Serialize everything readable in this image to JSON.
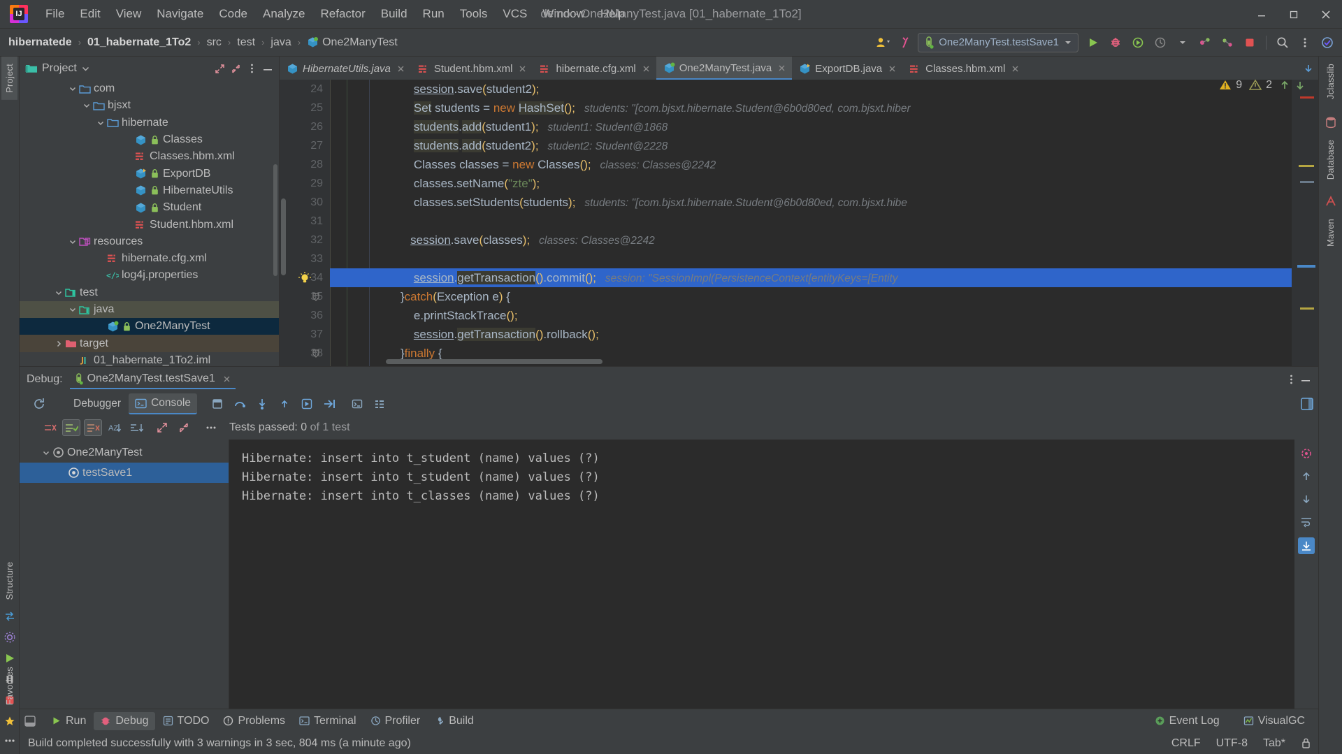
{
  "window": {
    "title": "demo - One2ManyTest.java [01_habernate_1To2]",
    "minimize": "minimize-icon",
    "maximize": "maximize-icon",
    "close": "close-icon"
  },
  "menu": [
    "File",
    "Edit",
    "View",
    "Navigate",
    "Code",
    "Analyze",
    "Refactor",
    "Build",
    "Run",
    "Tools",
    "VCS",
    "Window",
    "Help"
  ],
  "breadcrumbs": [
    {
      "label": "hibernatede",
      "bold": true
    },
    {
      "label": "01_habernate_1To2",
      "bold": true
    },
    {
      "label": "src",
      "bold": false
    },
    {
      "label": "test",
      "bold": false
    },
    {
      "label": "java",
      "bold": false
    },
    {
      "label": "One2ManyTest",
      "bold": false,
      "icon": "java-class-icon"
    }
  ],
  "toolbar": {
    "run_config": "One2ManyTest.testSave1",
    "run_config_icon": "test-tube-icon",
    "dropdown_icon": "chevron-down-icon",
    "run_icon": "run-icon",
    "debug_icon": "debug-icon",
    "run_with_coverage_icon": "run-coverage-icon",
    "profiler_icon": "profiler-icon",
    "stop_icon": "stop-icon",
    "search_icon": "search-icon",
    "more_icon": "more-vertical-icon",
    "updates_icon": "updates-icon",
    "share_icon": "share-icon",
    "users_icon": "users-icon"
  },
  "project_panel": {
    "title": "Project",
    "title_dropdown": "chevron-down-icon",
    "expand_icon": "expand-icon",
    "collapse_icon": "collapse-icon",
    "more_icon": "more-vertical-icon",
    "hide_icon": "hide-icon",
    "tree": [
      {
        "label": "com",
        "indent": 4,
        "arrow": "down",
        "icon": "folder-blue-icon",
        "state": "none"
      },
      {
        "label": "bjsxt",
        "indent": 5,
        "arrow": "down",
        "icon": "folder-blue-icon",
        "state": "none"
      },
      {
        "label": "hibernate",
        "indent": 6,
        "arrow": "down",
        "icon": "folder-blue-icon",
        "state": "none"
      },
      {
        "label": "Classes",
        "indent": 8,
        "arrow": "none",
        "icon": "java-class-icon",
        "lock": true,
        "state": "none"
      },
      {
        "label": "Classes.hbm.xml",
        "indent": 8,
        "arrow": "none",
        "icon": "xml-icon",
        "state": "none"
      },
      {
        "label": "ExportDB",
        "indent": 8,
        "arrow": "none",
        "icon": "java-class-run-icon",
        "lock": true,
        "state": "none"
      },
      {
        "label": "HibernateUtils",
        "indent": 8,
        "arrow": "none",
        "icon": "java-class-icon",
        "lock": true,
        "state": "none"
      },
      {
        "label": "Student",
        "indent": 8,
        "arrow": "none",
        "icon": "java-class-icon",
        "lock": true,
        "state": "none"
      },
      {
        "label": "Student.hbm.xml",
        "indent": 8,
        "arrow": "none",
        "icon": "xml-icon",
        "state": "none"
      },
      {
        "label": "resources",
        "indent": 4,
        "arrow": "down",
        "icon": "folder-resources-icon",
        "state": "none"
      },
      {
        "label": "hibernate.cfg.xml",
        "indent": 6,
        "arrow": "none",
        "icon": "xml-icon",
        "state": "none"
      },
      {
        "label": "log4j.properties",
        "indent": 6,
        "arrow": "none",
        "icon": "properties-icon",
        "state": "none"
      },
      {
        "label": "test",
        "indent": 3,
        "arrow": "down",
        "icon": "folder-test-icon",
        "state": "none"
      },
      {
        "label": "java",
        "indent": 4,
        "arrow": "down",
        "icon": "folder-test-src-icon",
        "state": "green"
      },
      {
        "label": "One2ManyTest",
        "indent": 6,
        "arrow": "none",
        "icon": "java-test-class-icon",
        "lock": true,
        "state": "blue"
      },
      {
        "label": "target",
        "indent": 3,
        "arrow": "right",
        "icon": "folder-excluded-icon",
        "state": "tan"
      },
      {
        "label": "01_habernate_1To2.iml",
        "indent": 4,
        "arrow": "none",
        "icon": "iml-icon",
        "state": "none"
      }
    ]
  },
  "editor": {
    "tabs": [
      {
        "label": "HibernateUtils.java",
        "icon": "java-class-icon",
        "active": false,
        "italic": true,
        "close": "close-icon"
      },
      {
        "label": "Student.hbm.xml",
        "icon": "xml-icon",
        "active": false,
        "italic": false,
        "close": "close-icon"
      },
      {
        "label": "hibernate.cfg.xml",
        "icon": "xml-icon",
        "active": false,
        "italic": false,
        "close": "close-icon"
      },
      {
        "label": "One2ManyTest.java",
        "icon": "java-test-class-icon",
        "active": true,
        "italic": false,
        "close": "close-icon"
      },
      {
        "label": "ExportDB.java",
        "icon": "java-class-run-icon",
        "active": false,
        "italic": false,
        "close": "close-icon"
      },
      {
        "label": "Classes.hbm.xml",
        "icon": "xml-icon",
        "active": false,
        "italic": false,
        "close": "close-icon"
      }
    ],
    "tabs_overflow_icon": "chevron-down-icon",
    "inspection": {
      "warning_icon": "warning-triangle-icon",
      "warning_count": "9",
      "weak_warning_icon": "weak-warning-icon",
      "weak_warning_count": "2",
      "prev_icon": "arrow-up-icon",
      "next_icon": "arrow-down-icon"
    },
    "first_line_number": 24,
    "highlighted_line": 34,
    "bulb_icon": "intention-bulb-icon",
    "lines": [
      {
        "n": 24,
        "code": "        session.save(student2);",
        "hint": ""
      },
      {
        "n": 25,
        "code": "        Set students = new HashSet();",
        "hint": "students: \"[com.bjsxt.hibernate.Student@6b0d80ed, com.bjsxt.hiber"
      },
      {
        "n": 26,
        "code": "        students.add(student1);",
        "hint": "student1: Student@1868"
      },
      {
        "n": 27,
        "code": "        students.add(student2);",
        "hint": "student2: Student@2228"
      },
      {
        "n": 28,
        "code": "        Classes classes = new Classes();",
        "hint": "classes: Classes@2242"
      },
      {
        "n": 29,
        "code": "        classes.setName(\"zte\");",
        "hint": ""
      },
      {
        "n": 30,
        "code": "        classes.setStudents(students);",
        "hint": "students: \"[com.bjsxt.hibernate.Student@6b0d80ed, com.bjsxt.hibe"
      },
      {
        "n": 31,
        "code": "",
        "hint": ""
      },
      {
        "n": 32,
        "code": "       session.save(classes);",
        "hint": "classes: Classes@2242"
      },
      {
        "n": 33,
        "code": "",
        "hint": ""
      },
      {
        "n": 34,
        "code": "        session.getTransaction().commit();",
        "hint": "session: \"SessionImpl(PersistenceContext[entityKeys=[Entity"
      },
      {
        "n": 35,
        "code": "    }catch(Exception e) {",
        "hint": ""
      },
      {
        "n": 36,
        "code": "        e.printStackTrace();",
        "hint": ""
      },
      {
        "n": 37,
        "code": "        session.getTransaction().rollback();",
        "hint": ""
      },
      {
        "n": 38,
        "code": "    }finally {",
        "hint": ""
      }
    ]
  },
  "debug_panel": {
    "label": "Debug:",
    "session_name": "One2ManyTest.testSave1",
    "session_icon": "test-tube-icon",
    "session_close_icon": "close-icon",
    "settings_icon": "more-vertical-icon",
    "hide_icon": "hide-icon",
    "layout_icon": "layout-icon",
    "restart_icon": "restart-icon",
    "tabs": [
      {
        "label": "Debugger",
        "icon": "debugger-icon",
        "selected": false
      },
      {
        "label": "Console",
        "icon": "console-icon",
        "selected": true
      }
    ],
    "stepper_icons": [
      "restore-layout-icon",
      "step-over-icon",
      "step-into-icon",
      "step-out-icon",
      "force-step-into-icon",
      "run-to-cursor-icon",
      "evaluate-icon",
      "threads-icon"
    ],
    "test_toolbar_icons": [
      "rerun-failed-icon",
      "show-passed-icon",
      "hide-passed-icon",
      "sort-alpha-icon",
      "sort-duration-icon",
      "expand-all-icon",
      "collapse-all-icon",
      "more-options-icon"
    ],
    "tests_passed_text": "Tests passed: 0",
    "tests_passed_suffix": "of 1 test",
    "tests": [
      {
        "label": "One2ManyTest",
        "icon": "test-suite-icon",
        "indent": 1,
        "arrow": "down",
        "selected": false
      },
      {
        "label": "testSave1",
        "icon": "test-method-icon",
        "indent": 2,
        "arrow": "none",
        "selected": true
      }
    ],
    "console_lines": [
      "Hibernate: insert into t_student (name) values (?)",
      "Hibernate: insert into t_student (name) values (?)",
      "Hibernate: insert into t_classes (name) values (?)"
    ]
  },
  "left_strip": {
    "project_tab": "Project",
    "structure_tab": "Structure",
    "favorites_tab": "Favorites",
    "icons": [
      "run-icon",
      "debug-icon",
      "pause-icon",
      "stop-icon",
      "star-icon",
      "more-icon",
      "settings-icon",
      "build-icon"
    ]
  },
  "right_strip": {
    "database_tab": "Database",
    "maven_tab": "Maven",
    "jclasslib_tab": "Jclasslib",
    "icons": [
      "database-icon",
      "maven-icon",
      "jclasslib-icon"
    ]
  },
  "bottom_bar": {
    "items": [
      {
        "label": "Run",
        "icon": "run-icon",
        "selected": false
      },
      {
        "label": "Debug",
        "icon": "debug-icon",
        "selected": true
      },
      {
        "label": "TODO",
        "icon": "todo-icon",
        "selected": false
      },
      {
        "label": "Problems",
        "icon": "problems-icon",
        "selected": false
      },
      {
        "label": "Terminal",
        "icon": "terminal-icon",
        "selected": false
      },
      {
        "label": "Profiler",
        "icon": "profiler-icon",
        "selected": false
      },
      {
        "label": "Build",
        "icon": "build-icon",
        "selected": false
      }
    ],
    "right": [
      {
        "label": "Event Log",
        "icon": "event-log-icon"
      },
      {
        "label": "VisualGC",
        "icon": "visualgc-icon"
      }
    ],
    "hide_icon": "hide-all-icon"
  },
  "status_bar": {
    "message": "Build completed successfully with 3 warnings in 3 sec, 804 ms (a minute ago)",
    "line_separator": "CRLF",
    "encoding": "UTF-8",
    "indent": "Tab*",
    "lock_icon": "lock-icon"
  },
  "colors": {
    "accent_blue": "#4a88c7",
    "selection_blue": "#2f65ca",
    "tree_selection": "#0d293e",
    "keyword_orange": "#cc7832",
    "string_green": "#6a8759",
    "number_blue": "#6897bb",
    "hint_gray": "#777c81",
    "editor_bg": "#2b2b2b",
    "panel_bg": "#3c3f41"
  }
}
